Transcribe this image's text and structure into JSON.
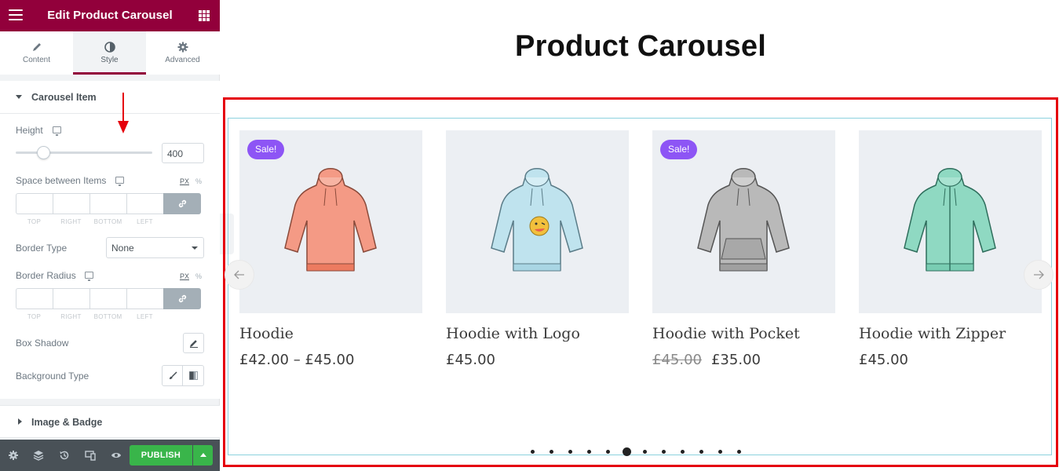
{
  "sidebar": {
    "title": "Edit Product Carousel",
    "tabs": [
      {
        "label": "Content",
        "icon": "pencil-icon"
      },
      {
        "label": "Style",
        "icon": "contrast-icon"
      },
      {
        "label": "Advanced",
        "icon": "gear-icon"
      }
    ],
    "active_tab": "Style",
    "sections": {
      "carousel_item": "Carousel Item",
      "image_badge": "Image & Badge"
    },
    "controls": {
      "height_label": "Height",
      "height_value": "400",
      "height_slider_fraction": 0.2,
      "space_label": "Space between Items",
      "border_type_label": "Border Type",
      "border_type_value": "None",
      "border_radius_label": "Border Radius",
      "box_shadow_label": "Box Shadow",
      "background_type_label": "Background Type",
      "unit_px": "PX",
      "unit_pct": "%",
      "dims": [
        "TOP",
        "RIGHT",
        "BOTTOM",
        "LEFT"
      ]
    },
    "footer": {
      "publish_label": "PUBLISH",
      "icons": [
        "gear-icon",
        "layers-icon",
        "history-icon",
        "responsive-icon",
        "eye-icon"
      ]
    }
  },
  "canvas": {
    "page_title": "Product Carousel",
    "products": [
      {
        "name": "Hoodie",
        "price": "£42.00 – £45.00",
        "old_price": "",
        "badge": "Sale!",
        "color": "#f49a85"
      },
      {
        "name": "Hoodie with Logo",
        "price": "£45.00",
        "old_price": "",
        "badge": "",
        "color": "#bfe3ee"
      },
      {
        "name": "Hoodie with Pocket",
        "price": "£35.00",
        "old_price": "£45.00",
        "badge": "Sale!",
        "color": "#b9b9b9"
      },
      {
        "name": "Hoodie with Zipper",
        "price": "£45.00",
        "old_price": "",
        "badge": "",
        "color": "#8fd9c2"
      }
    ],
    "pagination": {
      "total": 12,
      "active_index": 5
    },
    "colors": {
      "brand": "#92003b",
      "badge": "#8d55f5",
      "highlight": "#e5000c",
      "publish": "#39b54a"
    }
  }
}
